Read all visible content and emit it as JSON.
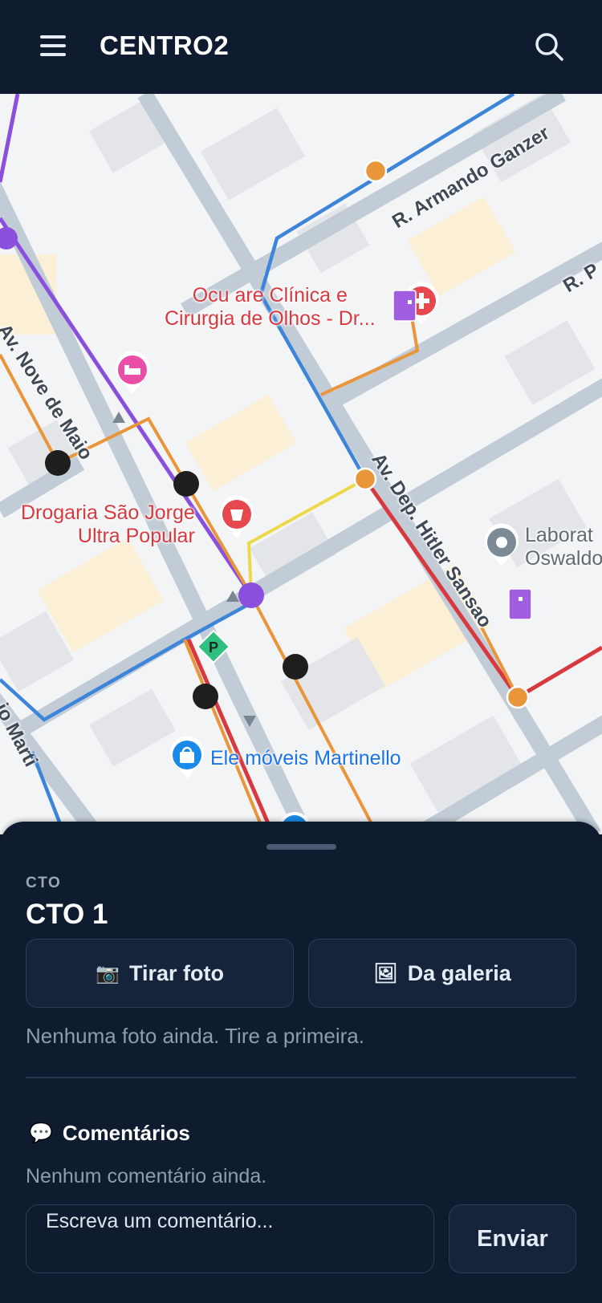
{
  "app": {
    "title": "CENTRO2"
  },
  "map": {
    "pois": {
      "clinic": "Ocu are Clínica e\nCirurgia de Olhos - Dr...",
      "pharmacy": "Drogaria São Jorge\nUltra Popular",
      "store": "Ele   móveis Martinello",
      "lab": "Laborat\nOswaldo"
    },
    "streets": {
      "armando": "R. Armando Ganzer",
      "r_p": "R. P",
      "nove_maio": "Av. Nove de Maio",
      "hitler": "Av. Dep. Hitler Sansao",
      "martin": "io Marti"
    },
    "parking_label": "P",
    "colors": {
      "purple": "#8a4fdc",
      "blue": "#3d85d8",
      "orange": "#e9953a",
      "red": "#d8393f",
      "yellow": "#ecd94a"
    }
  },
  "sheet": {
    "kicker": "CTO",
    "title": "CTO 1",
    "take_photo": {
      "icon": "📷",
      "label": "Tirar foto"
    },
    "gallery": {
      "icon": "🖼",
      "label": "Da galeria"
    },
    "no_photos": "Nenhuma foto ainda. Tire a primeira.",
    "comments": {
      "icon": "💬",
      "title": "Comentários",
      "empty": "Nenhum comentário ainda.",
      "placeholder": "Escreva um comentário...",
      "send": "Enviar"
    }
  }
}
